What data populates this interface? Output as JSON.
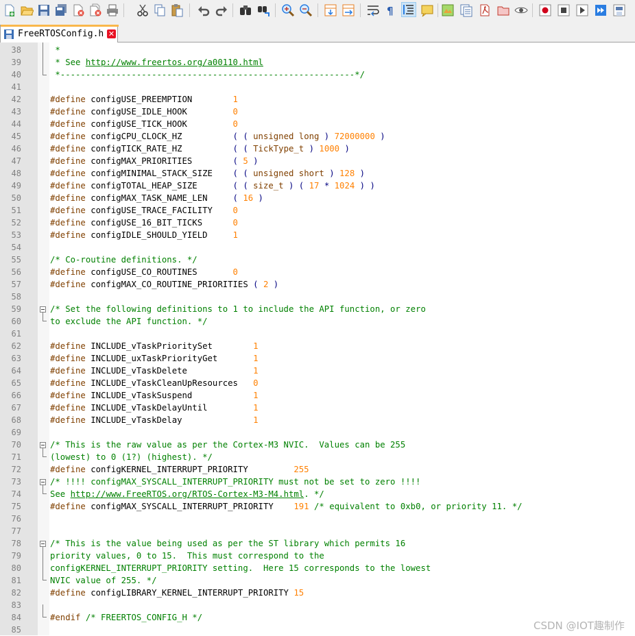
{
  "tab": {
    "title": "FreeRTOSConfig.h",
    "close_glyph": "✕"
  },
  "toolbar_icons": [
    "new-file-icon",
    "open-file-icon",
    "save-icon",
    "save-all-icon",
    "close-icon",
    "close-all-icon",
    "print-icon",
    "cut-icon",
    "copy-icon",
    "paste-icon",
    "undo-icon",
    "redo-icon",
    "find-icon",
    "replace-icon",
    "zoom-in-icon",
    "zoom-out-icon",
    "sync-vertical-icon",
    "sync-horizontal-icon",
    "word-wrap-icon",
    "show-all-characters-icon",
    "indent-guide-icon",
    "user-language-icon",
    "document-map-icon",
    "function-list-icon",
    "pdf-icon",
    "folder-workspace-icon",
    "monitoring-icon",
    "record-macro-icon",
    "stop-macro-icon",
    "play-macro-icon",
    "run-macro-multiple-icon",
    "save-macro-icon"
  ],
  "editor": {
    "lines": [
      {
        "n": "38",
        "s": [
          [
            "cm",
            " *"
          ]
        ]
      },
      {
        "n": "39",
        "s": [
          [
            "cm",
            " * See "
          ],
          [
            "ln2",
            "http://www.freertos.org/a00110.html"
          ]
        ]
      },
      {
        "n": "40",
        "s": [
          [
            "cm",
            " *----------------------------------------------------------*/"
          ]
        ]
      },
      {
        "n": "41",
        "s": []
      },
      {
        "n": "42",
        "s": [
          [
            "pp",
            "#define"
          ],
          [
            "",
            "configUSE_PREEMPTION        "
          ],
          [
            "nm",
            "1"
          ]
        ]
      },
      {
        "n": "43",
        "s": [
          [
            "pp",
            "#define"
          ],
          [
            "",
            "configUSE_IDLE_HOOK         "
          ],
          [
            "nm",
            "0"
          ]
        ]
      },
      {
        "n": "44",
        "s": [
          [
            "pp",
            "#define"
          ],
          [
            "",
            "configUSE_TICK_HOOK         "
          ],
          [
            "nm",
            "0"
          ]
        ]
      },
      {
        "n": "45",
        "s": [
          [
            "pp",
            "#define"
          ],
          [
            "",
            "configCPU_CLOCK_HZ          "
          ],
          [
            "op",
            "( ( "
          ],
          [
            "pp",
            "unsigned long"
          ],
          [
            "op",
            " ) "
          ],
          [
            "nm",
            "72000000"
          ],
          [
            "op",
            " )"
          ]
        ]
      },
      {
        "n": "46",
        "s": [
          [
            "pp",
            "#define"
          ],
          [
            "",
            "configTICK_RATE_HZ          "
          ],
          [
            "op",
            "( ( "
          ],
          [
            "pp",
            "TickType_t"
          ],
          [
            "op",
            " ) "
          ],
          [
            "nm",
            "1000"
          ],
          [
            "op",
            " )"
          ]
        ]
      },
      {
        "n": "47",
        "s": [
          [
            "pp",
            "#define"
          ],
          [
            "",
            "configMAX_PRIORITIES        "
          ],
          [
            "op",
            "( "
          ],
          [
            "nm",
            "5"
          ],
          [
            "op",
            " )"
          ]
        ]
      },
      {
        "n": "48",
        "s": [
          [
            "pp",
            "#define"
          ],
          [
            "",
            "configMINIMAL_STACK_SIZE    "
          ],
          [
            "op",
            "( ( "
          ],
          [
            "pp",
            "unsigned short"
          ],
          [
            "op",
            " ) "
          ],
          [
            "nm",
            "128"
          ],
          [
            "op",
            " )"
          ]
        ]
      },
      {
        "n": "49",
        "s": [
          [
            "pp",
            "#define"
          ],
          [
            "",
            "configTOTAL_HEAP_SIZE       "
          ],
          [
            "op",
            "( ( "
          ],
          [
            "pp",
            "size_t"
          ],
          [
            "op",
            " ) ( "
          ],
          [
            "nm",
            "17"
          ],
          [
            "op",
            " * "
          ],
          [
            "nm",
            "1024"
          ],
          [
            "op",
            " ) )"
          ]
        ]
      },
      {
        "n": "50",
        "s": [
          [
            "pp",
            "#define"
          ],
          [
            "",
            "configMAX_TASK_NAME_LEN     "
          ],
          [
            "op",
            "( "
          ],
          [
            "nm",
            "16"
          ],
          [
            "op",
            " )"
          ]
        ]
      },
      {
        "n": "51",
        "s": [
          [
            "pp",
            "#define"
          ],
          [
            "",
            "configUSE_TRACE_FACILITY    "
          ],
          [
            "nm",
            "0"
          ]
        ]
      },
      {
        "n": "52",
        "s": [
          [
            "pp",
            "#define"
          ],
          [
            "",
            "configUSE_16_BIT_TICKS      "
          ],
          [
            "nm",
            "0"
          ]
        ]
      },
      {
        "n": "53",
        "s": [
          [
            "pp",
            "#define"
          ],
          [
            "",
            "configIDLE_SHOULD_YIELD     "
          ],
          [
            "nm",
            "1"
          ]
        ]
      },
      {
        "n": "54",
        "s": []
      },
      {
        "n": "55",
        "s": [
          [
            "cm",
            "/* Co-routine definitions. */"
          ]
        ]
      },
      {
        "n": "56",
        "s": [
          [
            "pp",
            "#define"
          ],
          [
            "",
            "configUSE_CO_ROUTINES       "
          ],
          [
            "nm",
            "0"
          ]
        ]
      },
      {
        "n": "57",
        "s": [
          [
            "pp",
            "#define"
          ],
          [
            "",
            "configMAX_CO_ROUTINE_PRIORITIES "
          ],
          [
            "op",
            "( "
          ],
          [
            "nm",
            "2"
          ],
          [
            "op",
            " )"
          ]
        ]
      },
      {
        "n": "58",
        "s": []
      },
      {
        "n": "59",
        "s": [
          [
            "cm",
            "/* Set the following definitions to 1 to include the API function, or zero"
          ]
        ]
      },
      {
        "n": "60",
        "s": [
          [
            "cm",
            "to exclude the API function. */"
          ]
        ]
      },
      {
        "n": "61",
        "s": []
      },
      {
        "n": "62",
        "s": [
          [
            "pp",
            "#define"
          ],
          [
            "",
            "INCLUDE_vTaskPrioritySet        "
          ],
          [
            "nm",
            "1"
          ]
        ]
      },
      {
        "n": "63",
        "s": [
          [
            "pp",
            "#define"
          ],
          [
            "",
            "INCLUDE_uxTaskPriorityGet       "
          ],
          [
            "nm",
            "1"
          ]
        ]
      },
      {
        "n": "64",
        "s": [
          [
            "pp",
            "#define"
          ],
          [
            "",
            "INCLUDE_vTaskDelete             "
          ],
          [
            "nm",
            "1"
          ]
        ]
      },
      {
        "n": "65",
        "s": [
          [
            "pp",
            "#define"
          ],
          [
            "",
            "INCLUDE_vTaskCleanUpResources   "
          ],
          [
            "nm",
            "0"
          ]
        ]
      },
      {
        "n": "66",
        "s": [
          [
            "pp",
            "#define"
          ],
          [
            "",
            "INCLUDE_vTaskSuspend            "
          ],
          [
            "nm",
            "1"
          ]
        ]
      },
      {
        "n": "67",
        "s": [
          [
            "pp",
            "#define"
          ],
          [
            "",
            "INCLUDE_vTaskDelayUntil         "
          ],
          [
            "nm",
            "1"
          ]
        ]
      },
      {
        "n": "68",
        "s": [
          [
            "pp",
            "#define"
          ],
          [
            "",
            "INCLUDE_vTaskDelay              "
          ],
          [
            "nm",
            "1"
          ]
        ]
      },
      {
        "n": "69",
        "s": []
      },
      {
        "n": "70",
        "s": [
          [
            "cm",
            "/* This is the raw value as per the Cortex-M3 NVIC.  Values can be 255"
          ]
        ]
      },
      {
        "n": "71",
        "s": [
          [
            "cm",
            "(lowest) to 0 (1?) (highest). */"
          ]
        ]
      },
      {
        "n": "72",
        "s": [
          [
            "pp",
            "#define"
          ],
          [
            "",
            "configKERNEL_INTERRUPT_PRIORITY         "
          ],
          [
            "nm",
            "255"
          ]
        ]
      },
      {
        "n": "73",
        "s": [
          [
            "cm",
            "/* !!!! configMAX_SYSCALL_INTERRUPT_PRIORITY must not be set to zero !!!!"
          ]
        ]
      },
      {
        "n": "74",
        "s": [
          [
            "cm",
            "See "
          ],
          [
            "ln2",
            "http://www.FreeRTOS.org/RTOS-Cortex-M3-M4.html"
          ],
          [
            "cm",
            ". */"
          ]
        ]
      },
      {
        "n": "75",
        "s": [
          [
            "pp",
            "#define"
          ],
          [
            "",
            "configMAX_SYSCALL_INTERRUPT_PRIORITY    "
          ],
          [
            "nm",
            "191"
          ],
          [
            "cm",
            " /* equivalent to 0xb0, or priority 11. */"
          ]
        ]
      },
      {
        "n": "76",
        "s": []
      },
      {
        "n": "77",
        "s": []
      },
      {
        "n": "78",
        "s": [
          [
            "cm",
            "/* This is the value being used as per the ST library which permits 16"
          ]
        ]
      },
      {
        "n": "79",
        "s": [
          [
            "cm",
            "priority values, 0 to 15.  This must correspond to the"
          ]
        ]
      },
      {
        "n": "80",
        "s": [
          [
            "cm",
            "configKERNEL_INTERRUPT_PRIORITY setting.  Here 15 corresponds to the lowest"
          ]
        ]
      },
      {
        "n": "81",
        "s": [
          [
            "cm",
            "NVIC value of 255. */"
          ]
        ]
      },
      {
        "n": "82",
        "s": [
          [
            "pp",
            "#define"
          ],
          [
            "",
            "configLIBRARY_KERNEL_INTERRUPT_PRIORITY "
          ],
          [
            "nm",
            "15"
          ]
        ]
      },
      {
        "n": "83",
        "s": []
      },
      {
        "n": "84",
        "s": [
          [
            "pp",
            "#endif"
          ],
          [
            "cm",
            " /* FREERTOS_CONFIG_H */"
          ]
        ]
      },
      {
        "n": "85",
        "s": []
      }
    ]
  },
  "watermark": "CSDN @IOT趣制作",
  "colors": {
    "preprocessor": "#804000",
    "number": "#ff8000",
    "operator": "#000080",
    "comment": "#008000",
    "gutter": "#e4e4e4",
    "tab_accent": "#fab74b"
  }
}
